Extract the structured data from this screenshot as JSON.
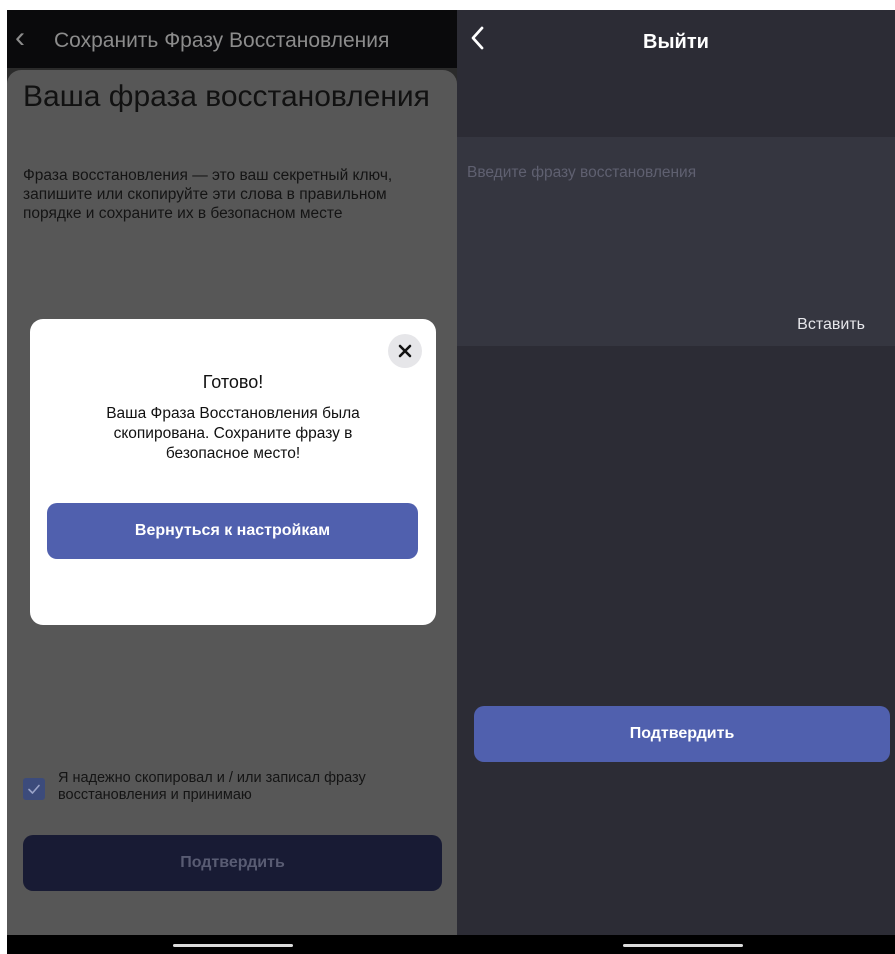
{
  "left": {
    "header": {
      "back_icon": "chevron-left-icon",
      "title": "Сохранить Фразу Восстановления"
    },
    "heading": "Ваша фраза восстановления",
    "description": "Фраза восстановления — это ваш секретный ключ, запишите или скопируйте эти слова в правильном порядке и сохраните их в безопасном месте",
    "checkbox": {
      "checked": true,
      "label": "Я надежно скопировал и / или записал фразу восстановления и принимаю"
    },
    "confirm_label": "Подтвердить"
  },
  "modal": {
    "close_icon": "close-icon",
    "title": "Готово!",
    "message": "Ваша Фраза Восстановления была скопирована. Сохраните фразу в безопасное место!",
    "button_label": "Вернуться к настройкам"
  },
  "right": {
    "header": {
      "back_icon": "chevron-left-icon",
      "title": "Выйти"
    },
    "phrase_input": {
      "placeholder": "Введите фразу восстановления",
      "value": ""
    },
    "paste_label": "Вставить",
    "confirm_label": "Подтвердить"
  },
  "colors": {
    "accent": "#5060ae",
    "overlay_bg": "#575757",
    "right_bg": "#2c2c35",
    "checkbox": "#3c4b7b"
  }
}
